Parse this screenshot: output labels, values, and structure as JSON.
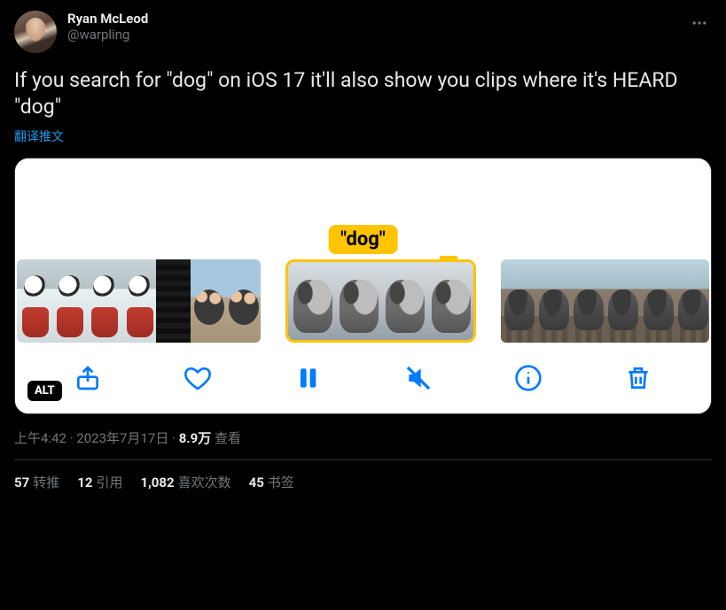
{
  "author": {
    "name": "Ryan McLeod",
    "handle": "@warpling"
  },
  "tweet_text": "If you search for \"dog\" on iOS 17 it'll also show you clips where it's HEARD \"dog\"",
  "translate_label": "翻译推文",
  "media": {
    "highlight_tag": "\"dog\"",
    "alt_badge": "ALT"
  },
  "meta": {
    "time": "上午4:42",
    "date": "2023年7月17日",
    "views_value": "8.9万",
    "views_label": "查看",
    "separator": " · "
  },
  "stats": {
    "retweets": {
      "value": "57",
      "label": "转推"
    },
    "quotes": {
      "value": "12",
      "label": "引用"
    },
    "likes": {
      "value": "1,082",
      "label": "喜欢次数"
    },
    "bookmarks": {
      "value": "45",
      "label": "书签"
    }
  }
}
